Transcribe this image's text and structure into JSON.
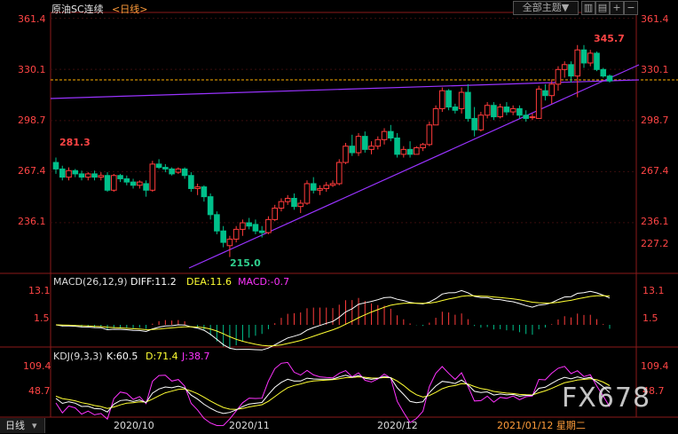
{
  "header": {
    "instrument": "原油SC连续",
    "period": "<日线>",
    "theme_button": "全部主题▼",
    "icons": [
      "layout-icon",
      "chart-settings-icon",
      "zoom-in-icon",
      "zoom-out-icon"
    ]
  },
  "colors": {
    "background": "#000000",
    "up": "#ff3b3b",
    "down": "#00c08b",
    "price_axis_text": "#ff4545",
    "trendline": "#9933ff",
    "dashed_line": "#ffb000",
    "diff": "#ffffff",
    "dea": "#ffff33",
    "k": "#ffffff",
    "d": "#ffff33",
    "j": "#ff33ff"
  },
  "price_axis": {
    "ticks": [
      "361.4",
      "330.1",
      "298.7",
      "267.4",
      "236.1"
    ],
    "current": "227.2"
  },
  "annotations": {
    "high": "345.7",
    "low": "215.0",
    "left_peak": "281.3"
  },
  "macd": {
    "title": "MACD(26,12,9)",
    "diff": "DIFF:11.2",
    "dea": "DEA:11.6",
    "macd": "MACD:-0.7",
    "ticks": [
      "13.1",
      "1.5"
    ]
  },
  "kdj": {
    "title": "KDJ(9,3,3)",
    "k": "K:60.5",
    "d": "D:71.4",
    "j": "J:38.7",
    "ticks": [
      "109.4",
      "48.7"
    ]
  },
  "bottom": {
    "period_tab": "日线",
    "dates": [
      "2020/10",
      "2020/11",
      "2020/12"
    ],
    "cursor_date": "2021/01/12 星期二",
    "watermark": "FX678"
  },
  "chart_data": {
    "type": "candlestick",
    "ylim": [
      205,
      365
    ],
    "ylabel_ticks": [
      361.4,
      330.1,
      298.7,
      267.4,
      236.1
    ],
    "x_labels": [
      "2020/10",
      "2020/11",
      "2020/12"
    ],
    "last_date": "2021/01/12",
    "annotations": [
      {
        "label": "281.3"
      },
      {
        "label": "215.0"
      },
      {
        "label": "345.7"
      }
    ],
    "candles": [
      [
        273,
        276,
        266,
        269
      ],
      [
        269,
        271,
        262,
        264
      ],
      [
        264,
        270,
        262,
        268
      ],
      [
        268,
        269,
        264,
        266
      ],
      [
        266,
        268,
        262,
        264
      ],
      [
        264,
        267,
        262,
        266
      ],
      [
        266,
        268,
        262,
        264
      ],
      [
        264,
        267,
        262,
        265
      ],
      [
        265,
        267,
        255,
        256
      ],
      [
        256,
        266,
        255,
        265
      ],
      [
        265,
        266,
        261,
        263
      ],
      [
        263,
        265,
        259,
        261
      ],
      [
        261,
        263,
        257,
        259
      ],
      [
        259,
        262,
        257,
        261
      ],
      [
        260,
        262,
        252,
        256
      ],
      [
        256,
        274,
        255,
        272
      ],
      [
        272,
        275,
        269,
        270
      ],
      [
        270,
        272,
        267,
        269
      ],
      [
        269,
        270,
        265,
        266
      ],
      [
        267,
        270,
        266,
        269
      ],
      [
        269,
        270,
        263,
        265
      ],
      [
        265,
        267,
        255,
        257
      ],
      [
        257,
        260,
        253,
        258
      ],
      [
        258,
        259,
        249,
        252
      ],
      [
        252,
        254,
        238,
        241
      ],
      [
        241,
        243,
        229,
        231
      ],
      [
        231,
        234,
        221,
        224
      ],
      [
        222,
        228,
        215,
        226
      ],
      [
        226,
        234,
        224,
        232
      ],
      [
        232,
        238,
        228,
        236
      ],
      [
        236,
        239,
        232,
        234
      ],
      [
        235,
        238,
        229,
        231
      ],
      [
        231,
        234,
        227,
        230
      ],
      [
        230,
        240,
        229,
        238
      ],
      [
        238,
        247,
        237,
        245
      ],
      [
        245,
        251,
        243,
        249
      ],
      [
        249,
        253,
        247,
        251
      ],
      [
        251,
        254,
        244,
        246
      ],
      [
        246,
        250,
        242,
        248
      ],
      [
        248,
        262,
        247,
        260
      ],
      [
        260,
        264,
        254,
        256
      ],
      [
        256,
        259,
        253,
        257
      ],
      [
        257,
        261,
        255,
        259
      ],
      [
        259,
        262,
        258,
        260
      ],
      [
        260,
        275,
        259,
        273
      ],
      [
        273,
        285,
        272,
        283
      ],
      [
        283,
        290,
        277,
        279
      ],
      [
        279,
        291,
        277,
        289
      ],
      [
        289,
        292,
        279,
        281
      ],
      [
        281,
        286,
        278,
        283
      ],
      [
        283,
        289,
        281,
        287
      ],
      [
        287,
        294,
        284,
        292
      ],
      [
        292,
        296,
        286,
        288
      ],
      [
        288,
        291,
        276,
        278
      ],
      [
        278,
        283,
        276,
        281
      ],
      [
        281,
        286,
        276,
        278
      ],
      [
        278,
        283,
        278,
        282
      ],
      [
        282,
        285,
        280,
        284
      ],
      [
        284,
        298,
        283,
        296
      ],
      [
        296,
        308,
        296,
        306
      ],
      [
        306,
        319,
        304,
        317
      ],
      [
        317,
        318,
        305,
        307
      ],
      [
        307,
        309,
        303,
        305
      ],
      [
        306,
        319,
        303,
        316
      ],
      [
        316,
        321,
        298,
        300
      ],
      [
        300,
        307,
        289,
        293
      ],
      [
        293,
        304,
        292,
        302
      ],
      [
        302,
        310,
        300,
        308
      ],
      [
        308,
        310,
        299,
        301
      ],
      [
        301,
        309,
        300,
        307
      ],
      [
        307,
        310,
        302,
        304
      ],
      [
        304,
        308,
        302,
        306
      ],
      [
        306,
        308,
        300,
        302
      ],
      [
        302,
        305,
        298,
        300
      ],
      [
        301,
        303,
        299,
        301
      ],
      [
        300,
        320,
        300,
        318
      ],
      [
        317,
        321,
        311,
        314
      ],
      [
        314,
        324,
        309,
        321
      ],
      [
        321,
        332,
        317,
        330
      ],
      [
        330,
        335,
        325,
        333
      ],
      [
        333,
        335,
        322,
        326
      ],
      [
        326,
        345,
        313,
        342
      ],
      [
        342,
        345,
        331,
        334
      ],
      [
        334,
        342,
        332,
        340
      ],
      [
        340,
        341,
        329,
        330
      ],
      [
        330,
        331,
        325,
        326
      ],
      [
        326,
        327,
        322,
        323
      ]
    ],
    "macd": {
      "dif_end": 11.2,
      "dea_end": 11.6,
      "macd_end": -0.7,
      "ylim": [
        -8,
        16
      ]
    },
    "kdj": {
      "k_end": 60.5,
      "d_end": 71.4,
      "j_end": 38.7,
      "ylim": [
        10,
        120
      ]
    }
  }
}
